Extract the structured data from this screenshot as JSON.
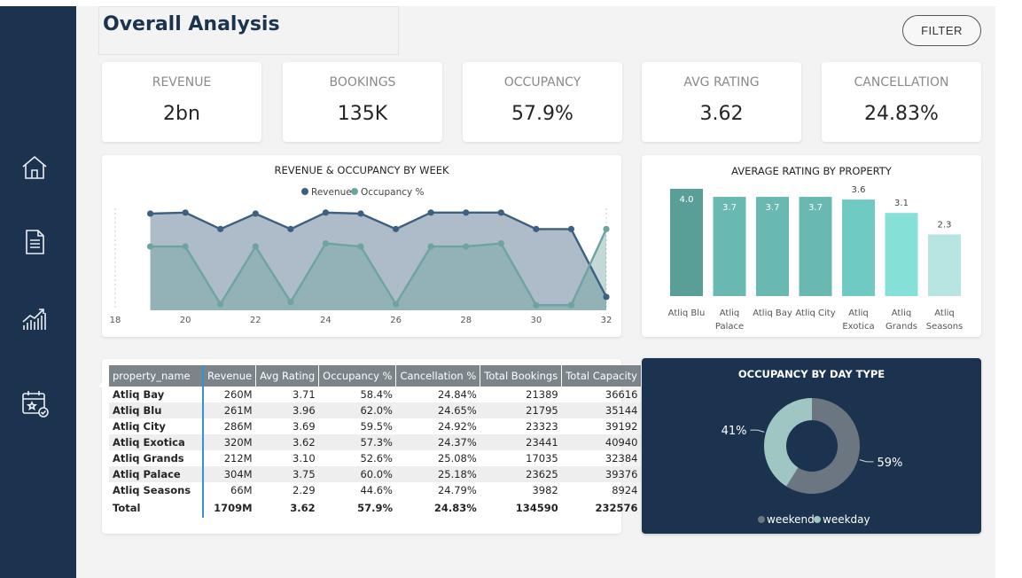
{
  "page": {
    "title": "Overall Analysis",
    "filter_label": "FILTER"
  },
  "nav": [
    {
      "name": "home-icon"
    },
    {
      "name": "document-icon"
    },
    {
      "name": "analytics-icon"
    },
    {
      "name": "calendar-icon"
    }
  ],
  "kpis": [
    {
      "label": "REVENUE",
      "value": "2bn"
    },
    {
      "label": "BOOKINGS",
      "value": "135K"
    },
    {
      "label": "OCCUPANCY",
      "value": "57.9%"
    },
    {
      "label": "AVG RATING",
      "value": "3.62"
    },
    {
      "label": "CANCELLATION",
      "value": "24.83%"
    }
  ],
  "colors": {
    "sidebar": "#1c3350",
    "revenue": "#3e6080",
    "occupancy": "#6ea4a0",
    "weekend": "#6b7680",
    "weekday": "#9fc6c2"
  },
  "chart_data": [
    {
      "type": "area",
      "title": "REVENUE & OCCUPANCY BY WEEK",
      "x": [
        19,
        20,
        21,
        22,
        23,
        24,
        25,
        26,
        27,
        28,
        29,
        30,
        31,
        32
      ],
      "x_ticks": [
        18,
        20,
        22,
        24,
        26,
        28,
        30,
        32
      ],
      "xlim": [
        18,
        32
      ],
      "series": [
        {
          "name": "Revenue",
          "values": [
            0.94,
            0.95,
            0.79,
            0.94,
            0.79,
            0.95,
            0.94,
            0.79,
            0.95,
            0.95,
            0.95,
            0.79,
            0.79,
            0.13
          ]
        },
        {
          "name": "Occupancy %",
          "values": [
            0.62,
            0.62,
            0.06,
            0.62,
            0.08,
            0.65,
            0.62,
            0.06,
            0.62,
            0.62,
            0.65,
            0.05,
            0.05,
            0.79
          ]
        }
      ],
      "legend": "top-center",
      "grid": false
    },
    {
      "type": "bar",
      "title": "AVERAGE RATING BY PROPERTY",
      "categories": [
        [
          "Atliq Blu"
        ],
        [
          "Atliq",
          "Palace"
        ],
        [
          "Atliq Bay"
        ],
        [
          "Atliq City"
        ],
        [
          "Atliq",
          "Exotica"
        ],
        [
          "Atliq",
          "Grands"
        ],
        [
          "Atliq",
          "Seasons"
        ]
      ],
      "values": [
        4.0,
        3.7,
        3.7,
        3.7,
        3.6,
        3.1,
        2.3
      ],
      "labels": [
        "4.0",
        "3.7",
        "3.7",
        "3.7",
        "3.6",
        "3.1",
        "2.3"
      ],
      "colors": [
        "#5a9e98",
        "#6ab8b2",
        "#6ab8b2",
        "#6ab8b2",
        "#6fcac3",
        "#85e0d8",
        "#b7e5e2"
      ],
      "ylim": [
        0,
        4.0
      ]
    },
    {
      "type": "pie",
      "title": "OCCUPANCY BY DAY TYPE",
      "categories": [
        "weekend",
        "weekday"
      ],
      "values": [
        59,
        41
      ],
      "labels": [
        "59%",
        "41%"
      ]
    }
  ],
  "table": {
    "columns": [
      "property_name",
      "Revenue",
      "Avg Rating",
      "Occupancy %",
      "Cancellation %",
      "Total Bookings",
      "Total Capacity"
    ],
    "rows": [
      [
        "Atliq Bay",
        "260M",
        "3.71",
        "58.4%",
        "24.84%",
        "21389",
        "36616"
      ],
      [
        "Atliq Blu",
        "261M",
        "3.96",
        "62.0%",
        "24.65%",
        "21795",
        "35144"
      ],
      [
        "Atliq City",
        "286M",
        "3.69",
        "59.5%",
        "24.92%",
        "23323",
        "39192"
      ],
      [
        "Atliq Exotica",
        "320M",
        "3.62",
        "57.3%",
        "24.37%",
        "23441",
        "40940"
      ],
      [
        "Atliq Grands",
        "212M",
        "3.10",
        "52.6%",
        "25.08%",
        "17035",
        "32384"
      ],
      [
        "Atliq Palace",
        "304M",
        "3.75",
        "60.0%",
        "25.18%",
        "23625",
        "39376"
      ],
      [
        "Atliq Seasons",
        "66M",
        "2.29",
        "44.6%",
        "24.79%",
        "3982",
        "8924"
      ]
    ],
    "total": [
      "Total",
      "1709M",
      "3.62",
      "57.9%",
      "24.83%",
      "134590",
      "232576"
    ]
  }
}
